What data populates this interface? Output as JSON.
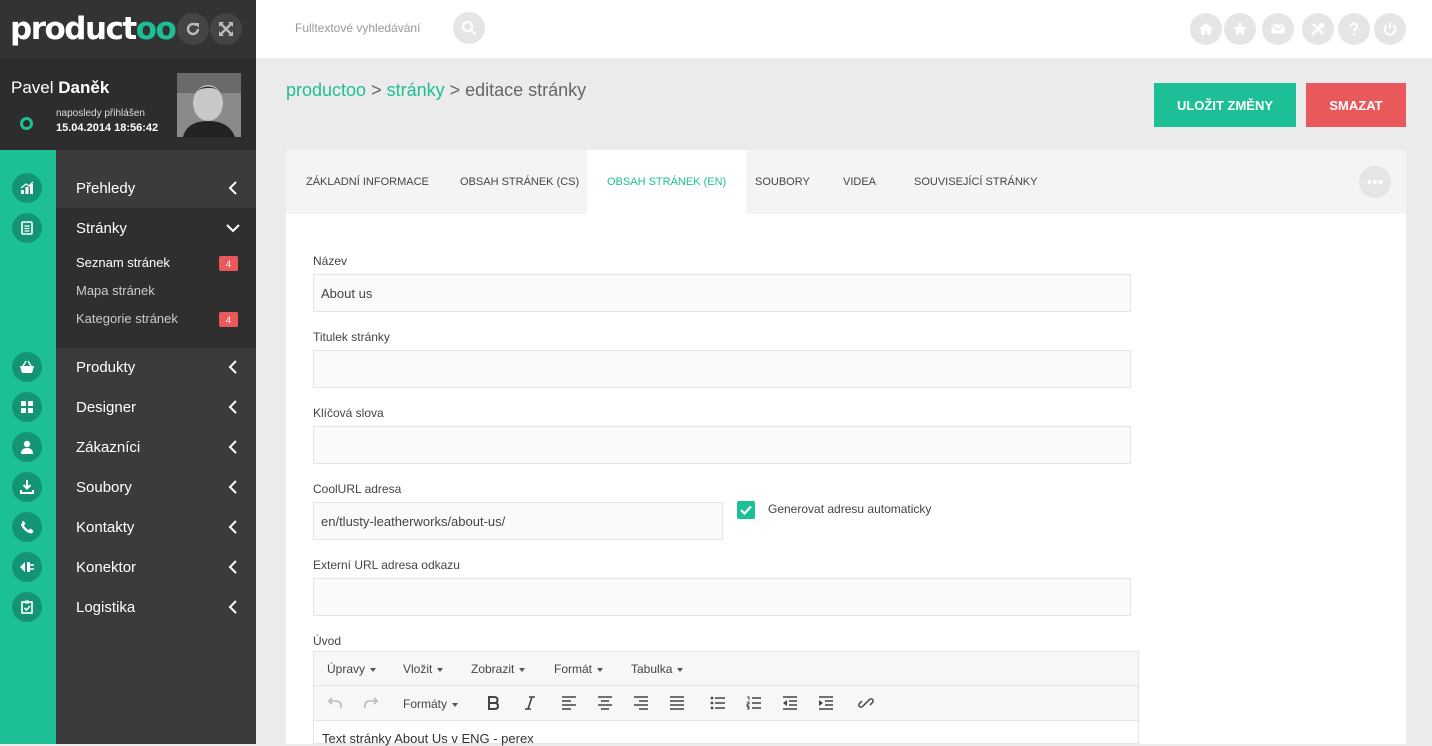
{
  "app": {
    "logo_main": "product",
    "logo_accent": "oo"
  },
  "user": {
    "first_name": "Pavel",
    "last_name": "Daněk",
    "last_login_label": "naposledy přihlášen",
    "last_login_value": "15.04.2014 18:56:42"
  },
  "nav": {
    "items": [
      {
        "label": "Přehledy",
        "icon": "chart-icon"
      },
      {
        "label": "Stránky",
        "icon": "document-icon"
      },
      {
        "label": "Produkty",
        "icon": "basket-icon"
      },
      {
        "label": "Designer",
        "icon": "grid-icon"
      },
      {
        "label": "Zákazníci",
        "icon": "person-icon"
      },
      {
        "label": "Soubory",
        "icon": "download-icon"
      },
      {
        "label": "Kontakty",
        "icon": "phone-icon"
      },
      {
        "label": "Konektor",
        "icon": "plug-icon"
      },
      {
        "label": "Logistika",
        "icon": "clipboard-check-icon"
      }
    ],
    "submenu": [
      {
        "label": "Seznam stránek",
        "badge": "4"
      },
      {
        "label": "Mapa stránek"
      },
      {
        "label": "Kategorie stránek",
        "badge": "4"
      }
    ]
  },
  "search": {
    "placeholder": "Fulltextové vyhledávání"
  },
  "breadcrumb": {
    "root": "productoo",
    "sep1": " > ",
    "section": "stránky",
    "sep2": " > ",
    "current": "editace stránky"
  },
  "actions": {
    "save": "ULOŽIT ZMĚNY",
    "delete": "SMAZAT"
  },
  "tabs": [
    "ZÁKLADNÍ INFORMACE",
    "OBSAH STRÁNEK (CS)",
    "OBSAH STRÁNEK (EN)",
    "SOUBORY",
    "VIDEA",
    "SOUVISEJÍCÍ STRÁNKY"
  ],
  "active_tab": "OBSAH STRÁNEK (EN)",
  "form": {
    "name_label": "Název",
    "name_value": "About us",
    "title_label": "Titulek stránky",
    "title_value": "",
    "keywords_label": "Klíčová slova",
    "keywords_value": "",
    "coolurl_label": "CoolURL adresa",
    "coolurl_value": "en/tlusty-leatherworks/about-us/",
    "auto_label": "Generovat adresu automaticky",
    "auto_checked": true,
    "external_label": "Externí URL adresa odkazu",
    "external_value": "",
    "intro_label": "Úvod"
  },
  "editor": {
    "menus": [
      "Úpravy",
      "Vložit",
      "Zobrazit",
      "Formát",
      "Tabulka"
    ],
    "formats_label": "Formáty",
    "content": "Text stránky About Us v ENG - perex"
  },
  "colors": {
    "accent": "#1dbf97",
    "danger": "#e9595b",
    "sidebar": "#3b3b3b"
  }
}
